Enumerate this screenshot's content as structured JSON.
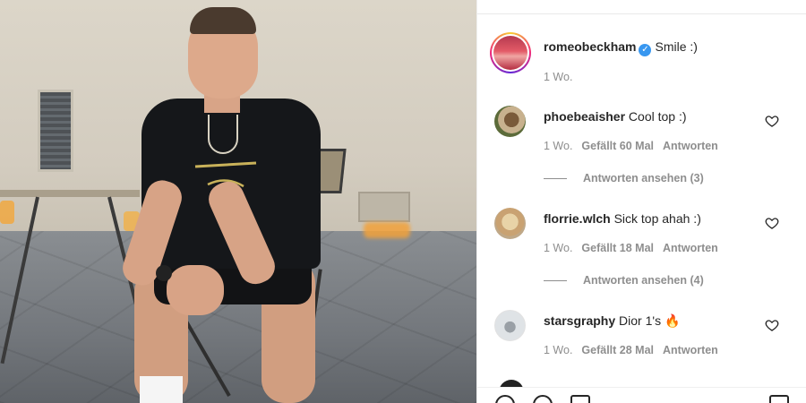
{
  "post": {
    "author": "romeobeckham",
    "verified": true,
    "caption": "Smile :)",
    "age": "1 Wo."
  },
  "comments": [
    {
      "username": "phoebeaisher",
      "text": "Cool top :)",
      "age": "1 Wo.",
      "likes": "Gefällt 60 Mal",
      "reply_label": "Antworten",
      "view_replies": "Antworten ansehen (3)"
    },
    {
      "username": "florrie.wlch",
      "text": "Sick top ahah :)",
      "age": "1 Wo.",
      "likes": "Gefällt 18 Mal",
      "reply_label": "Antworten",
      "view_replies": "Antworten ansehen (4)"
    },
    {
      "username": "starsgraphy",
      "text": "Dior 1's 🔥",
      "age": "1 Wo.",
      "likes": "Gefällt 28 Mal",
      "reply_label": "Antworten"
    }
  ],
  "icons": {
    "like": "heart-icon",
    "verified": "verified-badge-icon"
  },
  "colors": {
    "verified": "#3897f0",
    "meta_text": "#8e8e8e",
    "primary_text": "#262626"
  }
}
